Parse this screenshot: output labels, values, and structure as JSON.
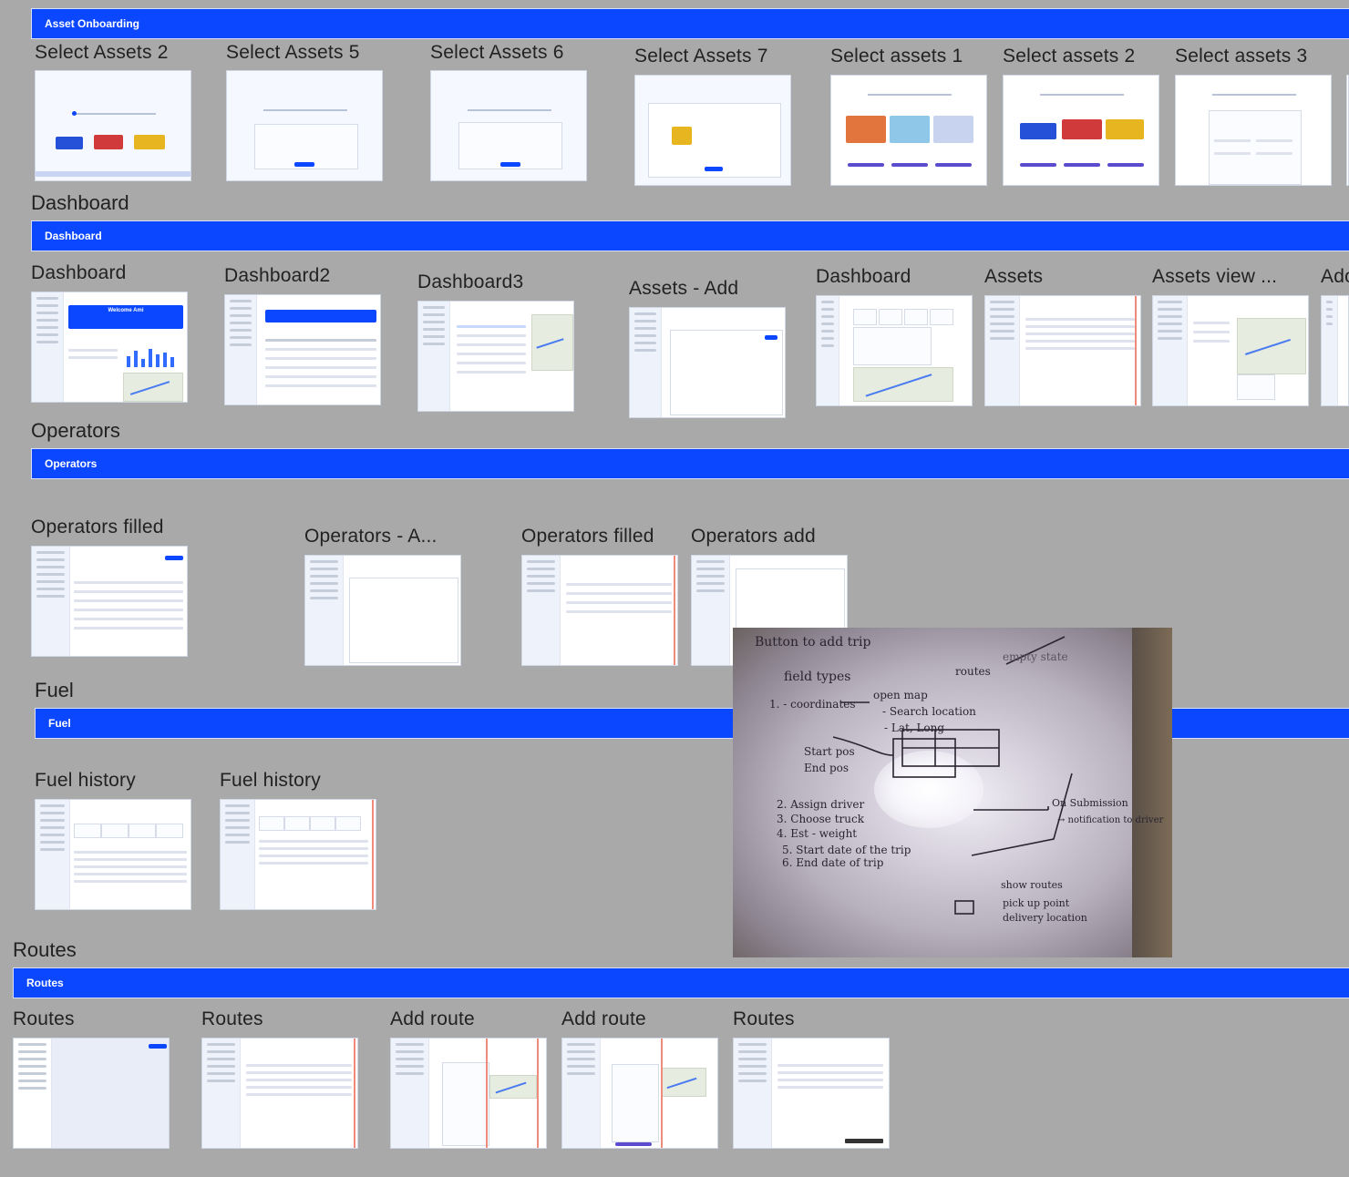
{
  "sections": {
    "asset_onboarding": {
      "title": "Asset Onboarding",
      "banner": "Asset Onboarding"
    },
    "dashboard": {
      "title": "Dashboard",
      "banner": "Dashboard"
    },
    "operators": {
      "title": "Operators",
      "banner": "Operators"
    },
    "fuel": {
      "title": "Fuel",
      "banner": "Fuel"
    },
    "routes": {
      "title": "Routes",
      "banner": "Routes"
    }
  },
  "frames": {
    "onboarding": [
      "Select Assets 2",
      "Select Assets 5",
      "Select Assets 6",
      "Select Assets 7",
      "Select assets 1",
      "Select assets 2",
      "Select assets 3"
    ],
    "dashboard": [
      "Dashboard",
      "Dashboard2",
      "Dashboard3",
      "Assets - Add",
      "Dashboard",
      "Assets",
      "Assets view ...",
      "Ado"
    ],
    "operators": [
      "Operators filled",
      "Operators - A...",
      "Operators filled",
      "Operators add"
    ],
    "fuel": [
      "Fuel history",
      "Fuel history"
    ],
    "routes": [
      "Routes",
      "Routes",
      "Add route",
      "Add route",
      "Routes"
    ]
  },
  "thumb_text": {
    "welcome": "Welcome Ami",
    "assets": "Assets",
    "app_name": "Sana Sana"
  },
  "whiteboard_notes": {
    "heading": "Button to add trip",
    "field_types": "field types",
    "line1": "1. - coordinates",
    "open_map": "open map",
    "search_location": "- Search location",
    "lat_long": "- Lat, Long",
    "start_pos": "Start pos",
    "end_pos": "End pos",
    "line2": "2. Assign driver",
    "line3": "3. Choose truck",
    "line4": "4. Est - weight",
    "line5": "5. Start date of the trip",
    "line6": "6. End date of trip",
    "routes": "routes",
    "empty_state": "empty state",
    "on_submission": "On Submission",
    "notification": "→ notification to driver",
    "show_routes": "show routes",
    "pick_up": "pick up point",
    "delivery": "delivery location"
  }
}
